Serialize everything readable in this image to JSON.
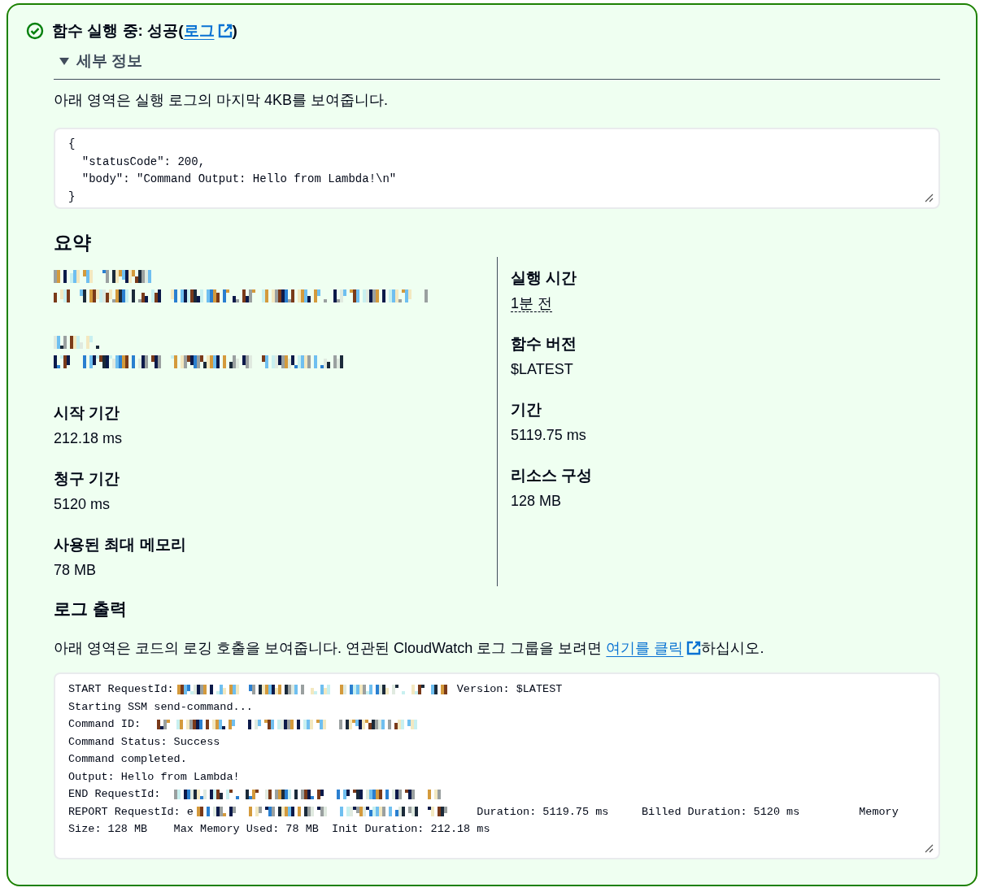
{
  "status": {
    "kind": "success",
    "title_prefix": "함수 실행 중: 성공(",
    "link": "로그",
    "title_suffix": ")"
  },
  "details": {
    "label": "세부 정보",
    "expanded": true
  },
  "intro": "아래 영역은 실행 로그의 마지막 4KB를 보여줍니다.",
  "result_lines": [
    "{",
    "  \"statusCode\": 200,",
    "  \"body\": \"Command Output: Hello from Lambda!\\n\"",
    "}"
  ],
  "summary": {
    "title": "요약",
    "left": [
      {
        "kind": "redacted"
      },
      {
        "kind": "redacted"
      },
      {
        "kind": "field",
        "label": "시작 기간",
        "value": "212.18 ms"
      },
      {
        "kind": "field",
        "label": "청구 기간",
        "value": "5120 ms"
      },
      {
        "kind": "field",
        "label": "사용된 최대 메모리",
        "value": "78 MB"
      }
    ],
    "right": [
      {
        "kind": "field",
        "label": "실행 시간",
        "value": "1분 전",
        "underlined": true
      },
      {
        "kind": "field",
        "label": "함수 버전",
        "value": "$LATEST"
      },
      {
        "kind": "field",
        "label": "기간",
        "value": "5119.75 ms"
      },
      {
        "kind": "field",
        "label": "리소스 구성",
        "value": "128 MB"
      }
    ]
  },
  "log_output": {
    "title": "로그 출력",
    "description_prefix": "아래 영역은 코드의 로깅 호출을 보여줍니다. 연관된 CloudWatch 로그 그룹을 보려면 ",
    "link": "여기를 클릭",
    "description_suffix": "하십시오.",
    "lines": [
      {
        "before": "START RequestId:",
        "redacted": true,
        "after": " Version: $LATEST"
      },
      {
        "before": "Starting SSM send-command...",
        "redacted": false
      },
      {
        "before": "Command ID: ",
        "redacted": true
      },
      {
        "before": "Command Status: Success",
        "redacted": false
      },
      {
        "before": "Command completed.",
        "redacted": false
      },
      {
        "before": "Output: Hello from Lambda!",
        "redacted": false
      },
      {
        "before": "END RequestId: ",
        "redacted": true
      },
      {
        "before": "REPORT RequestId: e",
        "redacted": true,
        "after": "    Duration: 5119.75 ms     Billed Duration: 5120 ms         Memory"
      },
      {
        "before": "Size: 128 MB    Max Memory Used: 78 MB  Init Duration: 212.18 ms",
        "redacted": false
      }
    ]
  }
}
